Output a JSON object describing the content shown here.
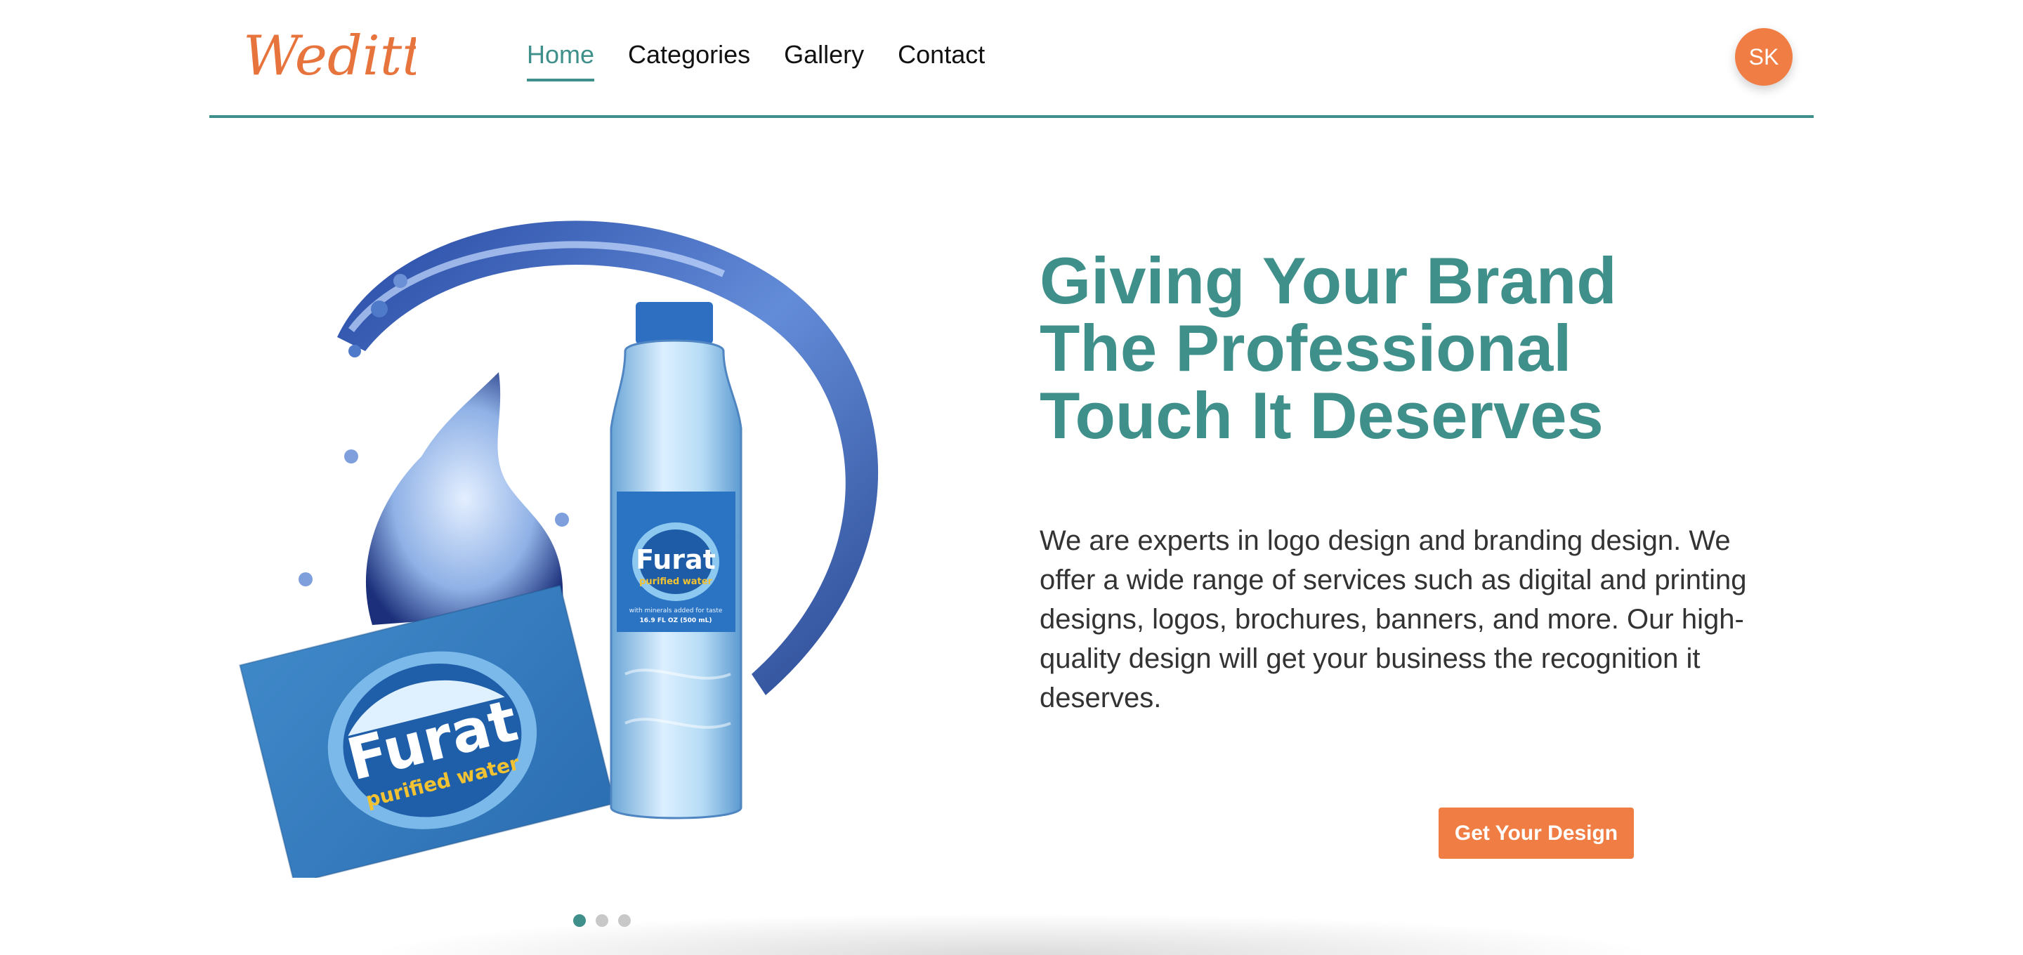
{
  "header": {
    "logo_text": "Weditt",
    "nav": [
      {
        "label": "Home",
        "active": true
      },
      {
        "label": "Categories",
        "active": false
      },
      {
        "label": "Gallery",
        "active": false
      },
      {
        "label": "Contact",
        "active": false
      }
    ],
    "avatar_initials": "SK"
  },
  "hero": {
    "title_lines": [
      "Giving Your Brand",
      "The Professional",
      "Touch It Deserves"
    ],
    "description": "We are experts in logo design and branding design. We offer a wide range of services such as digital and printing designs, logos, brochures, banners, and more. Our high-quality design will get your business the recognition it deserves.",
    "cta_label": "Get Your Design",
    "image": {
      "brand": "Furat",
      "tagline": "purified water",
      "bottle_note": "with minerals added for taste",
      "bottle_size": "16.9 FL OZ (500 mL)"
    }
  },
  "carousel": {
    "dot_count": 3,
    "active_index": 0
  },
  "colors": {
    "primary": "#3f8f8a",
    "accent": "#f07d44",
    "text": "#333333"
  }
}
